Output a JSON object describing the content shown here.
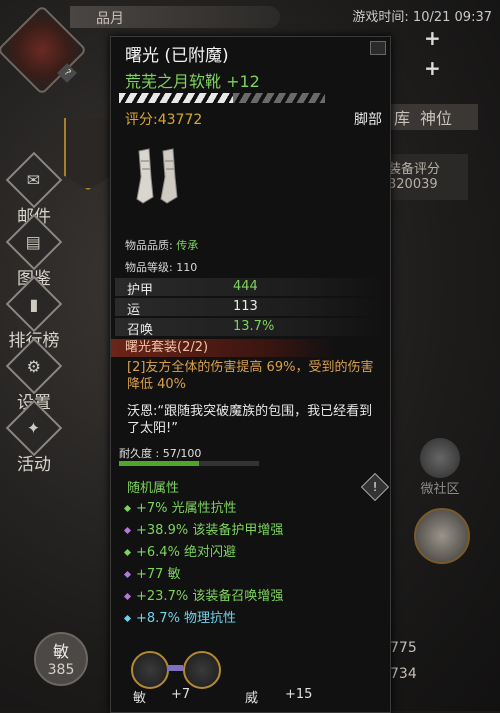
{
  "app": {
    "top_label": "品月",
    "clock": "游戏时间: 10/21 09:37"
  },
  "sidebar": {
    "items": [
      {
        "label": "邮件",
        "icon": "mail-icon",
        "glyph": "✉"
      },
      {
        "label": "图鉴",
        "icon": "book-icon",
        "glyph": "▤"
      },
      {
        "label": "排行榜",
        "icon": "ranking-icon",
        "glyph": "▮"
      },
      {
        "label": "设置",
        "icon": "gear-icon",
        "glyph": "⚙"
      },
      {
        "label": "活动",
        "icon": "event-icon",
        "glyph": "✦"
      }
    ],
    "badge": "?"
  },
  "right_bg": {
    "tabs": [
      "库",
      "神位"
    ],
    "score_label": "装备评分",
    "score_value": "320039",
    "social_label": "微社区",
    "num1": "775",
    "num2": "734"
  },
  "player": {
    "agi_label": "敏",
    "agi_value": "385"
  },
  "item": {
    "name": "曙光 (已附魔)",
    "subname": "荒芜之月软靴 +12",
    "rating": "评分:43772",
    "slot": "脚部",
    "quality_label": "物品品质:",
    "quality_value": "传承",
    "level_label": "物品等级:",
    "level_value": "110",
    "stats": [
      {
        "name": "护甲",
        "value": "444",
        "color": "#7dd35c"
      },
      {
        "name": "运",
        "value": "113",
        "color": "#eaeaea"
      },
      {
        "name": "召唤",
        "value": "13.7%",
        "color": "#7dd35c"
      }
    ],
    "set_name": "曙光套装(2/2)",
    "set_desc": "[2]友方全体的伤害提高 69%，受到的伤害降低 40%",
    "quote": "沃恩:“跟随我突破魔族的包围，我已经看到了太阳!”",
    "durability_label": "耐久度 :",
    "durability_value": "57/100",
    "durability_fraction": 0.57,
    "random_title": "随机属性",
    "random_attrs": [
      {
        "text": "+7% 光属性抗性",
        "color": "#7dd35c",
        "dot": "#7dd35c"
      },
      {
        "text": "+38.9% 该装备护甲增强",
        "color": "#7dd35c",
        "dot": "#b27ad9"
      },
      {
        "text": "+6.4% 绝对闪避",
        "color": "#7dd35c",
        "dot": "#7dd35c"
      },
      {
        "text": "+77 敏",
        "color": "#7dd35c",
        "dot": "#b27ad9"
      },
      {
        "text": "+23.7% 该装备召唤增强",
        "color": "#7dd35c",
        "dot": "#b27ad9"
      },
      {
        "text": "+8.7% 物理抗性",
        "color": "#6fd3e8",
        "dot": "#6fd3e8"
      }
    ],
    "gems": [
      {
        "label": "敏",
        "bonus": "+7"
      },
      {
        "label": "威",
        "bonus": "+15"
      }
    ],
    "warn_glyph": "!"
  }
}
